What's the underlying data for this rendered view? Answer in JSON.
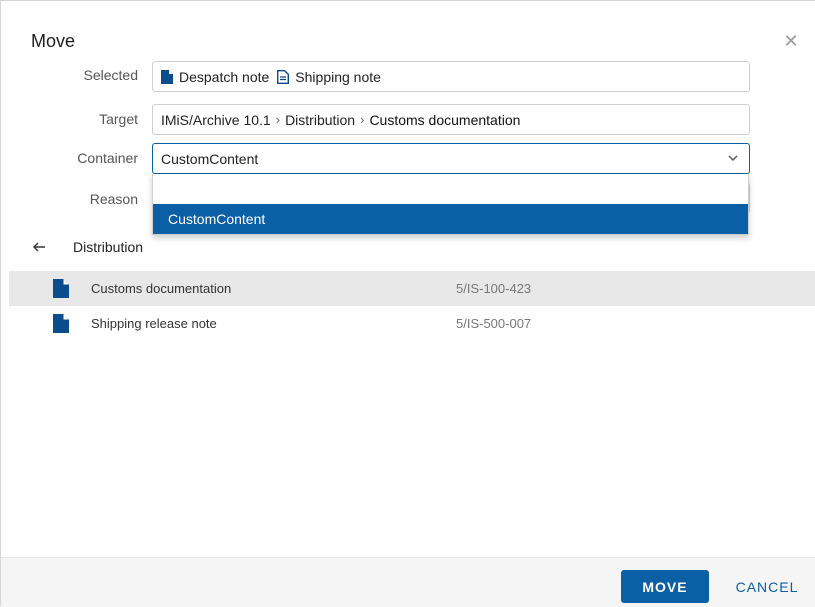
{
  "dialog": {
    "title": "Move",
    "close_icon": "close-icon"
  },
  "form": {
    "selected_label": "Selected",
    "selected_items": [
      "Despatch note",
      "Shipping note"
    ],
    "target_label": "Target",
    "target_path": [
      "IMiS/Archive 10.1",
      "Distribution",
      "Customs documentation"
    ],
    "container_label": "Container",
    "container_value": "CustomContent",
    "reason_label": "Reason"
  },
  "dropdown": {
    "options": [
      "",
      "CustomContent"
    ],
    "selected": "CustomContent"
  },
  "browser": {
    "current_folder": "Distribution",
    "items": [
      {
        "name": "Customs documentation",
        "code": "5/IS-100-423",
        "selected": true
      },
      {
        "name": "Shipping release note",
        "code": "5/IS-500-007",
        "selected": false
      }
    ]
  },
  "footer": {
    "move_label": "MOVE",
    "cancel_label": "CANCEL"
  },
  "colors": {
    "accent": "#0b5fa5",
    "selected_row": "#e8e8e8"
  }
}
